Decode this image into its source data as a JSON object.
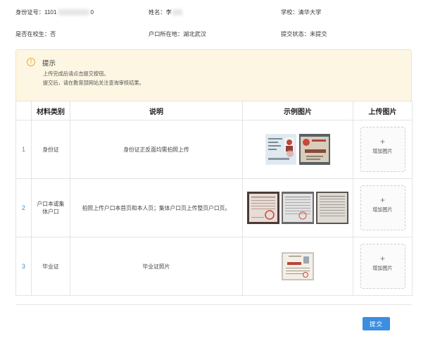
{
  "info": {
    "id_label": "身份证号：1101",
    "id_tail": "0",
    "name_label": "姓名：李",
    "school": "学校：清华大学",
    "in_school": "是否在校生：否",
    "hukou": "户口所在地：湖北武汉",
    "status": "提交状态：未提交"
  },
  "tip": {
    "title": "提示",
    "line1": "上传完成后请点击提交按钮。",
    "line2": "提交后，请在教育部网站关注查询审核结果。"
  },
  "table": {
    "headers": [
      "",
      "材料类别",
      "说明",
      "示例图片",
      "上传图片"
    ],
    "rows": [
      {
        "num": "1",
        "category": "身份证",
        "desc": "身份证正反面均需拍照上传"
      },
      {
        "num": "2",
        "category": "户口本或集体户口",
        "desc": "拍照上传户口本首页和本人页；集体户口页上传整页户口页。"
      },
      {
        "num": "3",
        "category": "毕业证",
        "desc": "毕业证照片"
      }
    ],
    "upload_plus": "+",
    "upload_label": "增加图片"
  },
  "submit_label": "提交",
  "colors": {
    "accent": "#3b8ee0",
    "tip_bg": "#fdf6e3",
    "warn": "#f0a92b"
  },
  "icons": {
    "tip": "warning-circle-icon",
    "upload": "plus-icon"
  }
}
